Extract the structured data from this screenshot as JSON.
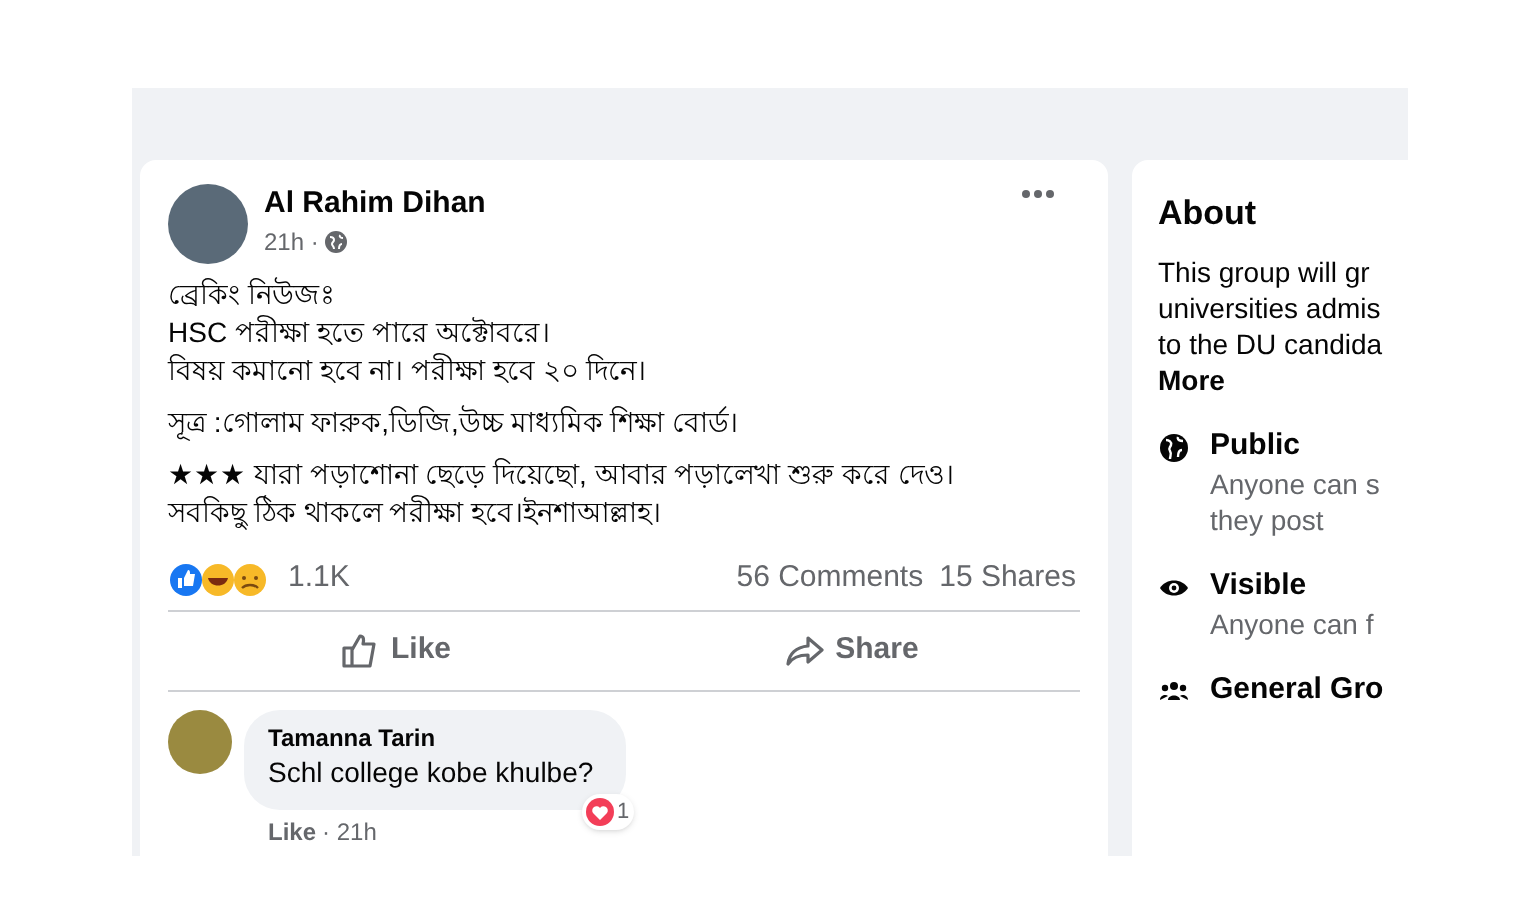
{
  "post": {
    "author": "Al Rahim Dihan",
    "time": "21h ·",
    "paragraphs": [
      [
        "ব্রেকিং নিউজঃ",
        "HSC পরীক্ষা হতে পারে অক্টোবরে।",
        "বিষয় কমানো হবে না। পরীক্ষা হবে ২০ দিনে।"
      ],
      [
        "সূত্র :গোলাম ফারুক,ডিজি,উচ্চ মাধ্যমিক শিক্ষা বোর্ড।"
      ],
      [
        "★★★ যারা পড়াশোনা ছেড়ে দিয়েছো, আবার পড়ালেখা শুরু করে দেও।",
        "সবকিছু ঠিক থাকলে পরীক্ষা হবে।ইনশাআল্লাহ।"
      ]
    ],
    "reaction_count": "1.1K",
    "comments": "56 Comments",
    "shares": "15 Shares",
    "actions": [
      "Like",
      "Share"
    ],
    "comment": {
      "author": "Tamanna Tarin",
      "text": "Schl college kobe khulbe?",
      "like": "Like",
      "time": "· 21h",
      "reaction_count": "1"
    }
  },
  "about": {
    "title": "About",
    "description": [
      "This group will gr",
      "universities admis",
      "to the DU candida"
    ],
    "more": "More",
    "items": [
      {
        "kind": "public",
        "title": "Public",
        "lines": [
          "Anyone can s",
          "they post"
        ]
      },
      {
        "kind": "visible",
        "title": "Visible",
        "lines": [
          "Anyone can f"
        ]
      },
      {
        "kind": "group",
        "title": "General Gro"
      }
    ]
  }
}
